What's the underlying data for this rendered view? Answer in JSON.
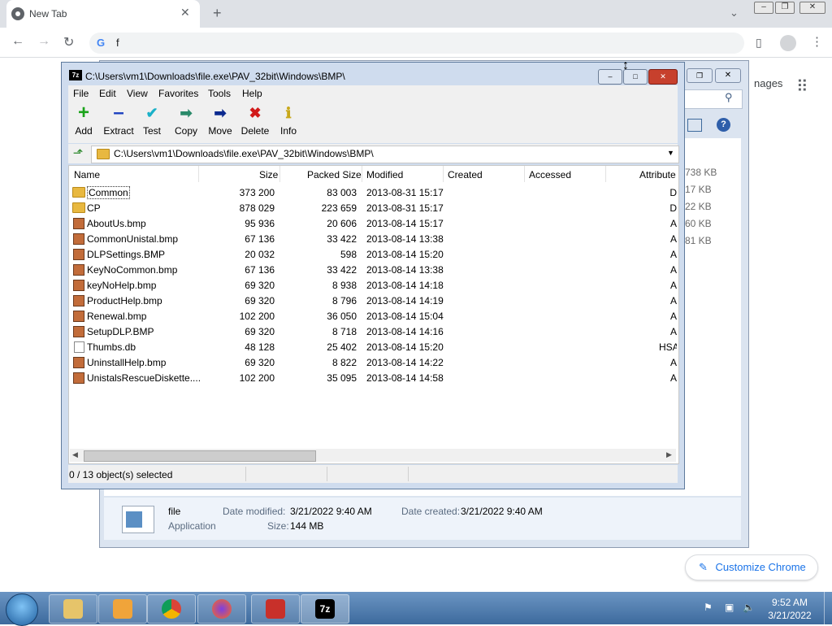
{
  "browser": {
    "tab_title": "New Tab",
    "address": "f",
    "customize_label": "Customize Chrome",
    "images_link": "nages"
  },
  "zip": {
    "title": "C:\\Users\\vm1\\Downloads\\file.exe\\PAV_32bit\\Windows\\BMP\\",
    "menu": [
      "File",
      "Edit",
      "View",
      "Favorites",
      "Tools",
      "Help"
    ],
    "toolbar": [
      "Add",
      "Extract",
      "Test",
      "Copy",
      "Move",
      "Delete",
      "Info"
    ],
    "path": "C:\\Users\\vm1\\Downloads\\file.exe\\PAV_32bit\\Windows\\BMP\\",
    "columns": [
      "Name",
      "Size",
      "Packed Size",
      "Modified",
      "Created",
      "Accessed",
      "Attribute"
    ],
    "rows": [
      {
        "name": "Common",
        "size": "373 200",
        "packed": "83 003",
        "modified": "2013-08-31 15:17",
        "attr": "D",
        "type": "folder"
      },
      {
        "name": "CP",
        "size": "878 029",
        "packed": "223 659",
        "modified": "2013-08-31 15:17",
        "attr": "D",
        "type": "folder"
      },
      {
        "name": "AboutUs.bmp",
        "size": "95 936",
        "packed": "20 606",
        "modified": "2013-08-14 15:17",
        "attr": "A",
        "type": "bmp"
      },
      {
        "name": "CommonUnistal.bmp",
        "size": "67 136",
        "packed": "33 422",
        "modified": "2013-08-14 13:38",
        "attr": "A",
        "type": "bmp"
      },
      {
        "name": "DLPSettings.BMP",
        "size": "20 032",
        "packed": "598",
        "modified": "2013-08-14 15:20",
        "attr": "A",
        "type": "bmp"
      },
      {
        "name": "KeyNoCommon.bmp",
        "size": "67 136",
        "packed": "33 422",
        "modified": "2013-08-14 13:38",
        "attr": "A",
        "type": "bmp"
      },
      {
        "name": "keyNoHelp.bmp",
        "size": "69 320",
        "packed": "8 938",
        "modified": "2013-08-14 14:18",
        "attr": "A",
        "type": "bmp"
      },
      {
        "name": "ProductHelp.bmp",
        "size": "69 320",
        "packed": "8 796",
        "modified": "2013-08-14 14:19",
        "attr": "A",
        "type": "bmp"
      },
      {
        "name": "Renewal.bmp",
        "size": "102 200",
        "packed": "36 050",
        "modified": "2013-08-14 15:04",
        "attr": "A",
        "type": "bmp"
      },
      {
        "name": "SetupDLP.BMP",
        "size": "69 320",
        "packed": "8 718",
        "modified": "2013-08-14 14:16",
        "attr": "A",
        "type": "bmp"
      },
      {
        "name": "Thumbs.db",
        "size": "48 128",
        "packed": "25 402",
        "modified": "2013-08-14 15:20",
        "attr": "HSA",
        "type": "db"
      },
      {
        "name": "UninstallHelp.bmp",
        "size": "69 320",
        "packed": "8 822",
        "modified": "2013-08-14 14:22",
        "attr": "A",
        "type": "bmp"
      },
      {
        "name": "UnistalsRescueDiskette....",
        "size": "102 200",
        "packed": "35 095",
        "modified": "2013-08-14 14:58",
        "attr": "A",
        "type": "bmp"
      }
    ],
    "status": "0 / 13 object(s) selected"
  },
  "explorer": {
    "sizes": [
      "738 KB",
      "17 KB",
      "22 KB",
      "60 KB",
      "81 KB"
    ],
    "file_name": "file",
    "file_type": "Application",
    "date_modified_label": "Date modified:",
    "date_modified": "3/21/2022 9:40 AM",
    "date_created_label": "Date created:",
    "date_created": "3/21/2022 9:40 AM",
    "size_label": "Size:",
    "size": "144 MB"
  },
  "taskbar": {
    "time": "9:52 AM",
    "date": "3/21/2022"
  }
}
